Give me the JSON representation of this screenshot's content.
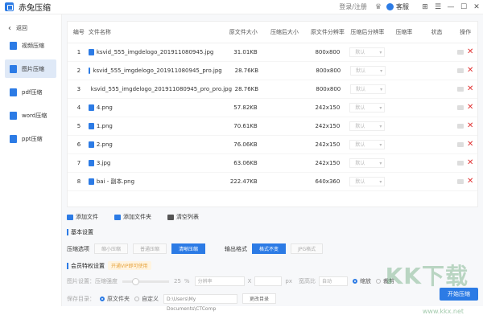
{
  "app": {
    "title": "赤兔压缩",
    "login": "登录/注册",
    "service": "客服"
  },
  "sidebar": {
    "back": "返回",
    "items": [
      {
        "label": "视频压缩",
        "active": false
      },
      {
        "label": "图片压缩",
        "active": true
      },
      {
        "label": "pdf压缩",
        "active": false
      },
      {
        "label": "word压缩",
        "active": false
      },
      {
        "label": "ppt压缩",
        "active": false
      }
    ]
  },
  "table": {
    "headers": [
      "编号",
      "文件名称",
      "原文件大小",
      "压缩后大小",
      "原文件分辨率",
      "压缩后分辨率",
      "压缩率",
      "状态",
      "操作"
    ],
    "rows": [
      {
        "num": "1",
        "name": "ksvid_555_imgdelogo_201911080945.jpg",
        "orig": "31.01KB",
        "res": "800x800",
        "after_res": "默认"
      },
      {
        "num": "2",
        "name": "ksvid_555_imgdelogo_201911080945_pro.jpg",
        "orig": "28.76KB",
        "res": "800x800",
        "after_res": "默认"
      },
      {
        "num": "3",
        "name": "ksvid_555_imgdelogo_201911080945_pro_pro.jpg",
        "orig": "28.76KB",
        "res": "800x800",
        "after_res": "默认"
      },
      {
        "num": "4",
        "name": "4.png",
        "orig": "57.82KB",
        "res": "242x150",
        "after_res": "默认"
      },
      {
        "num": "5",
        "name": "1.png",
        "orig": "70.61KB",
        "res": "242x150",
        "after_res": "默认"
      },
      {
        "num": "6",
        "name": "2.png",
        "orig": "76.06KB",
        "res": "242x150",
        "after_res": "默认"
      },
      {
        "num": "7",
        "name": "3.jpg",
        "orig": "63.06KB",
        "res": "242x150",
        "after_res": "默认"
      },
      {
        "num": "8",
        "name": "bai - 副本.png",
        "orig": "222.47KB",
        "res": "640x360",
        "after_res": "默认"
      }
    ]
  },
  "toolbar": {
    "add_file": "添加文件",
    "add_folder": "添加文件夹",
    "clear": "清空列表"
  },
  "basic": {
    "title": "基本设置",
    "compress_label": "压缩选项",
    "compress_opts": [
      {
        "label": "缩小压缩",
        "on": false
      },
      {
        "label": "普通压缩",
        "on": false
      },
      {
        "label": "清晰压缩",
        "on": true
      }
    ],
    "format_label": "输出格式",
    "format_opts": [
      {
        "label": "格式不变",
        "on": true
      },
      {
        "label": "JPG格式",
        "on": false
      }
    ]
  },
  "member": {
    "title": "会员特权设置",
    "badge": "开通VIP即可使用",
    "img_label": "图片设置：",
    "quality_label": "压缩强度",
    "quality_value": "25",
    "quality_unit": "%",
    "width_label": "分辨率",
    "x_sep": "X",
    "px": "px",
    "hw_label": "宽高比",
    "hw_value": "自动",
    "radio_ratio": "缩放",
    "radio_crop": "裁剪"
  },
  "save": {
    "label": "保存目录：",
    "radio_orig": "原文件夹",
    "radio_custom": "自定义",
    "path": "D:\\Users\\My Documents\\CTComp",
    "change": "更改目录"
  },
  "start": "开始压缩",
  "watermark": {
    "logo": "KK下载",
    "url": "www.kkx.net"
  },
  "colors": {
    "accent": "#2c7be5",
    "delete": "#e03131"
  }
}
